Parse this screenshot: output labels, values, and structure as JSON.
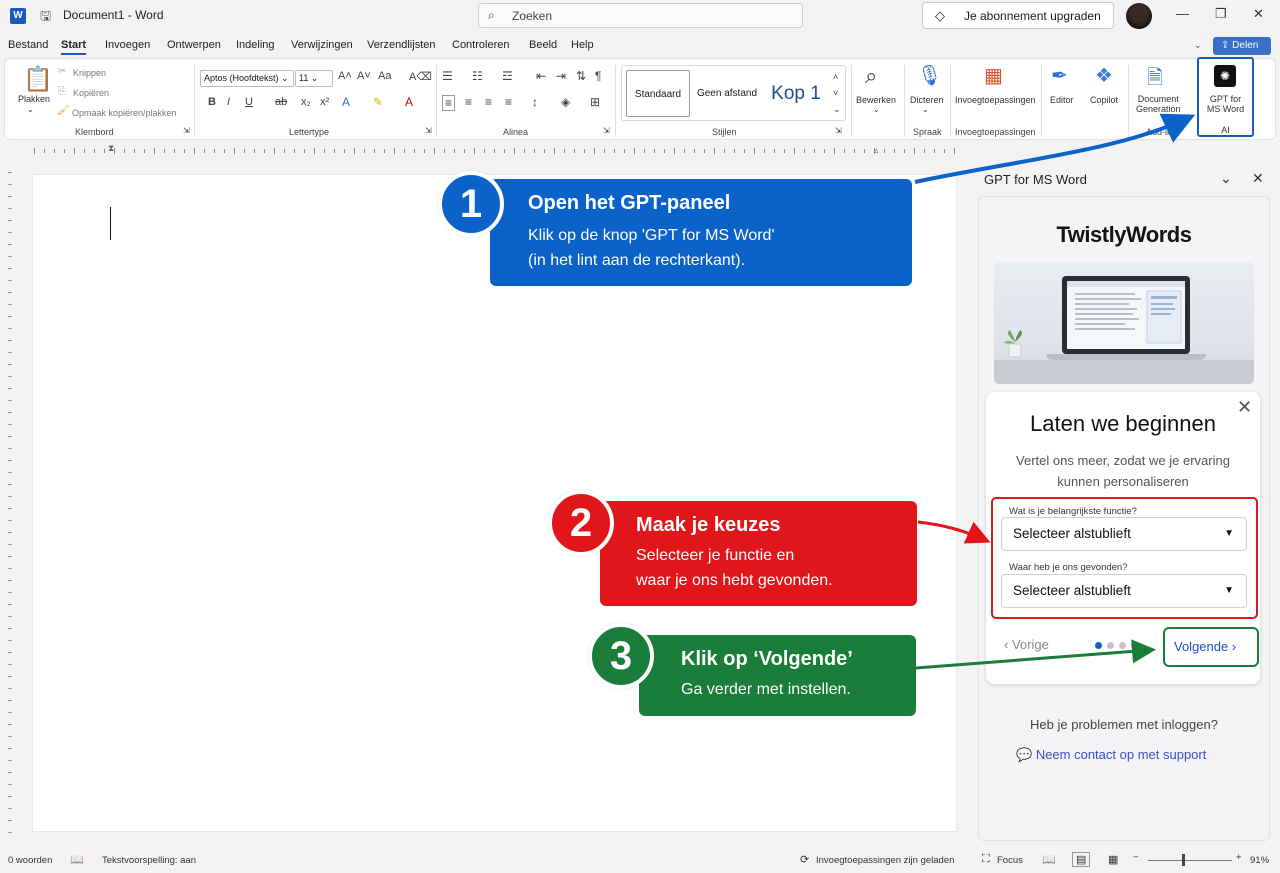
{
  "window": {
    "doc_name": "Document1",
    "app_separator": "-",
    "app_name": "Word",
    "search_placeholder": "Zoeken",
    "upgrade_label": "Je abonnement upgraden"
  },
  "menu": {
    "tabs": [
      "Bestand",
      "Start",
      "Invoegen",
      "Ontwerpen",
      "Indeling",
      "Verwijzingen",
      "Verzendlijsten",
      "Controleren",
      "Beeld",
      "Help"
    ],
    "active": "Start",
    "share_label": "Delen"
  },
  "ribbon": {
    "clipboard": {
      "paste": "Plakken",
      "cut": "Knippen",
      "copy": "Kopiëren",
      "format_painter": "Opmaak kopiëren/plakken",
      "group": "Klembord"
    },
    "font": {
      "family": "Aptos (Hoofdtekst)",
      "size": "11",
      "group": "Lettertype"
    },
    "paragraph": {
      "group": "Alinea"
    },
    "styles": {
      "items": [
        "Standaard",
        "Geen afstand",
        "Kop 1"
      ],
      "group": "Stijlen"
    },
    "editing": {
      "label": "Bewerken"
    },
    "voice": {
      "label": "Dicteren",
      "group": "Spraak"
    },
    "addins": {
      "label": "Invoegtoepassingen",
      "group": "Invoegtoepassingen"
    },
    "editor": {
      "label": "Editor"
    },
    "copilot": {
      "label": "Copilot"
    },
    "docgen": {
      "label_line1": "Document",
      "label_line2": "Generation",
      "group": "Add-in"
    },
    "gpt": {
      "label_line1": "GPT for",
      "label_line2": "MS Word",
      "group": "AI"
    }
  },
  "pane": {
    "title": "GPT for MS Word",
    "brand": "TwistlyWords",
    "card_title": "Laten we beginnen",
    "card_subtitle": "Vertel ons meer, zodat we je ervaring kunnen personaliseren",
    "q1_label": "Wat is je belangrijkste functie?",
    "q1_value": "Selecteer alstublieft",
    "q2_label": "Waar heb je ons gevonden?",
    "q2_value": "Selecteer alstublieft",
    "prev_label": "Vorige",
    "next_label": "Volgende",
    "help_text": "Heb je problemen met inloggen?",
    "support_link": "Neem contact op met support",
    "step_active": 1,
    "step_total": 4
  },
  "callouts": [
    {
      "number": "1",
      "title": "Open het GPT-paneel",
      "line1": "Klik op de knop 'GPT for MS Word'",
      "line2": "(in het lint aan de rechterkant).",
      "color": "#0b63c9"
    },
    {
      "number": "2",
      "title": "Maak je keuzes",
      "line1": "Selecteer je functie en",
      "line2": "waar je ons hebt gevonden.",
      "color": "#e0161b"
    },
    {
      "number": "3",
      "title": "Klik op ‘Volgende’",
      "line1": "Ga verder met instellen.",
      "color": "#1a7d3a"
    }
  ],
  "status": {
    "words": "0 woorden",
    "prediction": "Tekstvoorspelling: aan",
    "addins": "Invoegtoepassingen zijn geladen",
    "focus": "Focus",
    "zoom": "91%"
  },
  "colors": {
    "word_blue": "#185abd",
    "red": "#e0161b",
    "green": "#1a7d3a",
    "blue": "#0b63c9"
  }
}
